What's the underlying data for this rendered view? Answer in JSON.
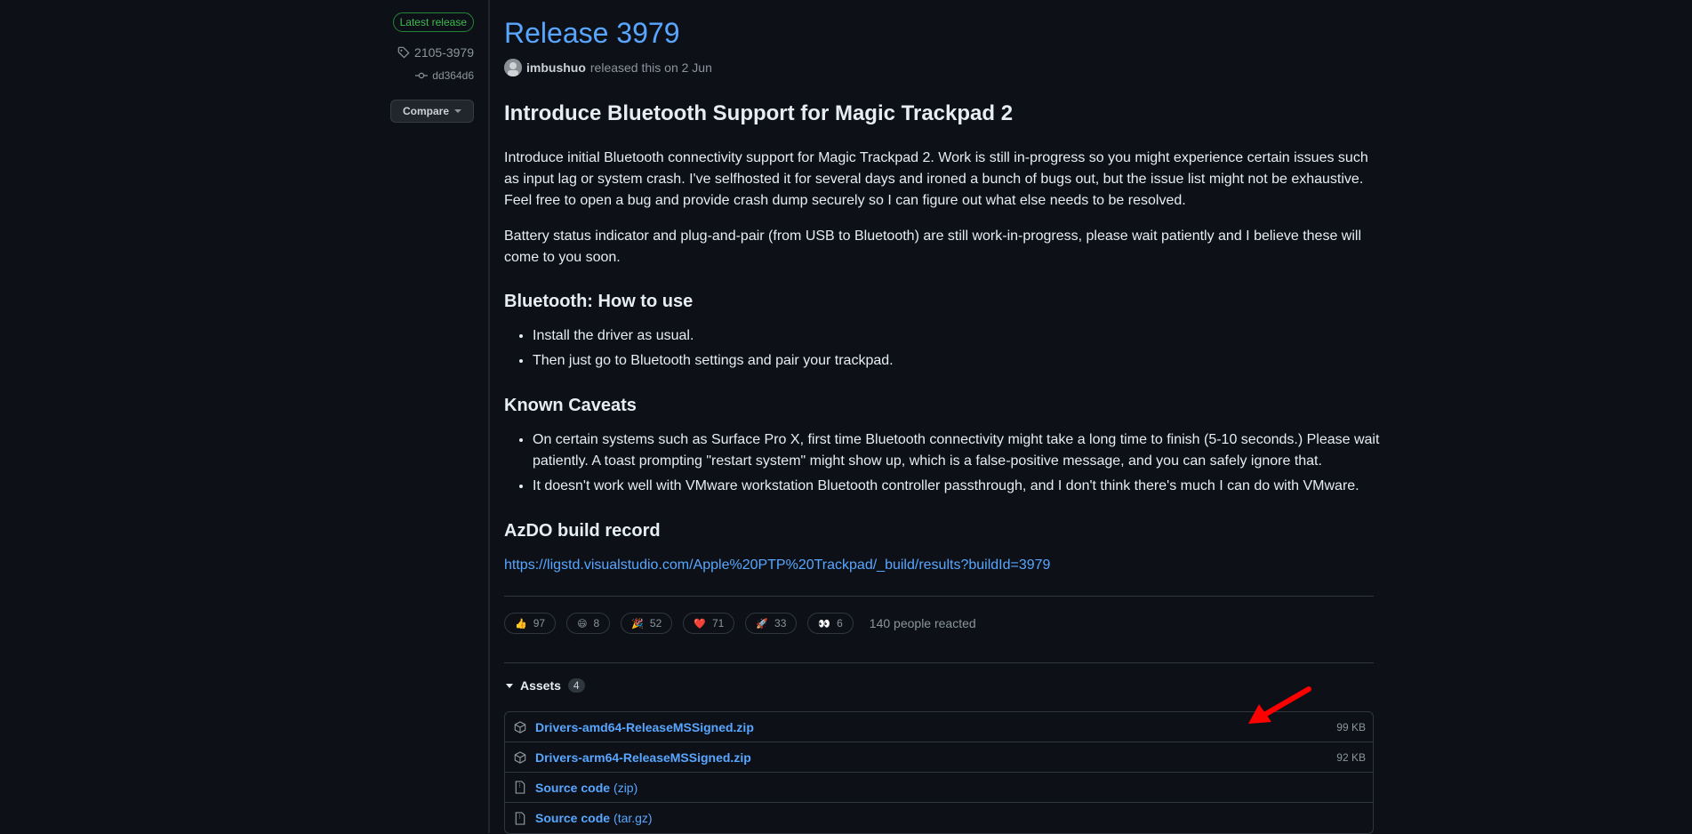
{
  "sidebar": {
    "badge": "Latest release",
    "tag": "2105-3979",
    "commit": "dd364d6",
    "compare": "Compare"
  },
  "release": {
    "title": "Release 3979",
    "author": "imbushuo",
    "released_text": "released this on 2 Jun"
  },
  "body": {
    "heading": "Introduce Bluetooth Support for Magic Trackpad 2",
    "para1": "Introduce initial Bluetooth connectivity support for Magic Trackpad 2. Work is still in-progress so you might experience certain issues such as input lag or system crash. I've selfhosted it for several days and ironed a bunch of bugs out, but the issue list might not be exhaustive. Feel free to open a bug and provide crash dump securely so I can figure out what else needs to be resolved.",
    "para2": "Battery status indicator and plug-and-pair (from USB to Bluetooth) are still work-in-progress, please wait patiently and I believe these will come to you soon.",
    "howto_heading": "Bluetooth: How to use",
    "howto_items": [
      "Install the driver as usual.",
      "Then just go to Bluetooth settings and pair your trackpad."
    ],
    "caveats_heading": "Known Caveats",
    "caveats_items": [
      "On certain systems such as Surface Pro X, first time Bluetooth connectivity might take a long time to finish (5-10 seconds.) Please wait patiently. A toast prompting \"restart system\" might show up, which is a false-positive message, and you can safely ignore that.",
      "It doesn't work well with VMware workstation Bluetooth controller passthrough, and I don't think there's much I can do with VMware."
    ],
    "azdo_heading": "AzDO build record",
    "azdo_link": "https://ligstd.visualstudio.com/Apple%20PTP%20Trackpad/_build/results?buildId=3979"
  },
  "reactions": {
    "items": [
      {
        "emoji": "👍",
        "count": "97"
      },
      {
        "emoji": "😄",
        "count": "8"
      },
      {
        "emoji": "🎉",
        "count": "52"
      },
      {
        "emoji": "❤️",
        "count": "71"
      },
      {
        "emoji": "🚀",
        "count": "33"
      },
      {
        "emoji": "👀",
        "count": "6"
      }
    ],
    "summary": "140 people reacted"
  },
  "assets": {
    "label": "Assets",
    "count": "4",
    "rows": [
      {
        "name": "Drivers-amd64-ReleaseMSSigned.zip",
        "size": "99 KB",
        "icon": "package-icon"
      },
      {
        "name": "Drivers-arm64-ReleaseMSSigned.zip",
        "size": "92 KB",
        "icon": "package-icon"
      },
      {
        "name": "Source code",
        "sub": "(zip)",
        "icon": "file-zip-icon"
      },
      {
        "name": "Source code",
        "sub": "(tar.gz)",
        "icon": "file-zip-icon"
      }
    ]
  },
  "colors": {
    "background": "#0d1117",
    "link": "#58a6ff",
    "badge_green": "#3fb950",
    "annotation_arrow": "#ff0000"
  }
}
